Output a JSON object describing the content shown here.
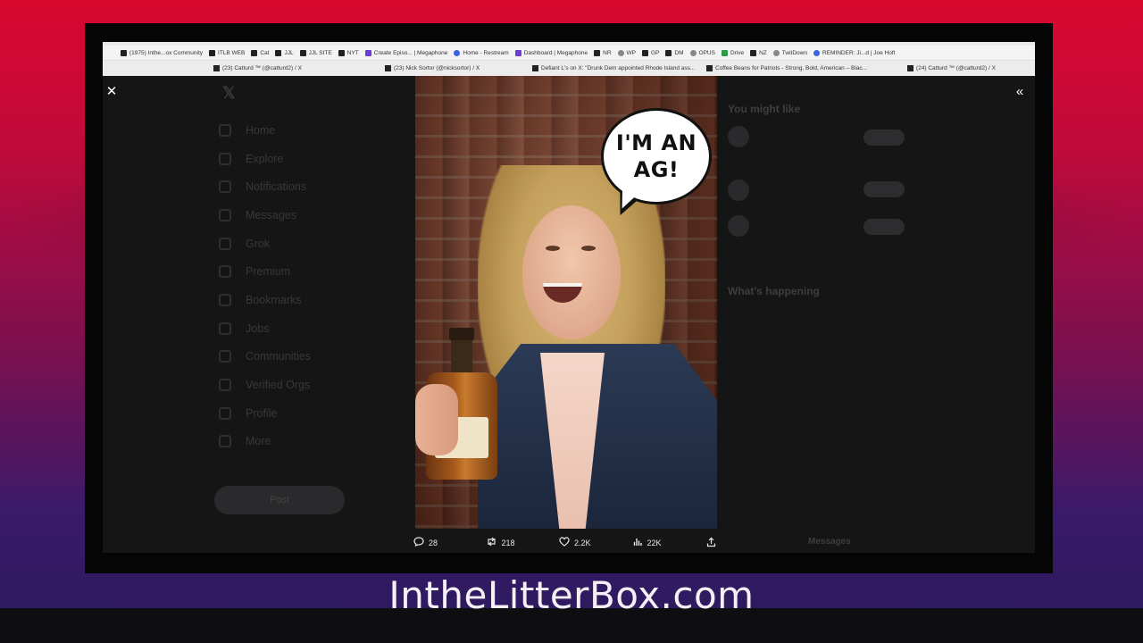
{
  "bookmarks_row1": [
    {
      "icon": "apps-icon",
      "label": "(1975) Inthe...ox Community"
    },
    {
      "icon": "itlb-icon",
      "label": "ITLB WEB"
    },
    {
      "icon": "x-icon",
      "label": "Cat"
    },
    {
      "icon": "x-icon",
      "label": "JJL"
    },
    {
      "icon": "jjl-icon",
      "label": "JJL SITE"
    },
    {
      "icon": "nyt-icon",
      "label": "NYT"
    },
    {
      "icon": "megaphone-icon",
      "label": "Create Episo... | Megaphone"
    },
    {
      "icon": "restream-icon",
      "label": "Home - Restream"
    },
    {
      "icon": "megaphone-icon",
      "label": "Dashboard | Megaphone"
    },
    {
      "icon": "nr-icon",
      "label": "NR"
    },
    {
      "icon": "globe-icon",
      "label": "WP"
    },
    {
      "icon": "gp-icon",
      "label": "GP"
    },
    {
      "icon": "dm-icon",
      "label": "DM"
    },
    {
      "icon": "opus-icon",
      "label": "OPUS"
    },
    {
      "icon": "drive-icon",
      "label": "Drive"
    },
    {
      "icon": "x-icon",
      "label": "NZ"
    },
    {
      "icon": "twitdown-icon",
      "label": "TwitDown"
    },
    {
      "icon": "reminder-icon",
      "label": "REMINDER: Ji...d | Joe Hoft"
    }
  ],
  "tabs_row2": [
    {
      "label": "(23) Catturd ™ (@catturd2) / X"
    },
    {
      "label": "(23) Nick Sortor (@nicksortor) / X"
    },
    {
      "label": "Defiant L's on X: \"Drunk Dem appointed Rhode Island ass..."
    },
    {
      "label": "Coffee Beans for Patriots - Strong, Bold, American – Blac..."
    },
    {
      "label": "(24) Catturd ™ (@catturd2) / X"
    }
  ],
  "left_nav": [
    "Home",
    "Explore",
    "Notifications",
    "Messages",
    "Grok",
    "Premium",
    "Bookmarks",
    "Jobs",
    "Communities",
    "Verified Orgs",
    "Profile",
    "More"
  ],
  "post_button": "Post",
  "right_col": {
    "you_might_like": "You might like",
    "whats_happening": "What's happening",
    "messages": "Messages"
  },
  "meme": {
    "bubble_text": "I'M AN\nAG!"
  },
  "actions": {
    "replies": "28",
    "reposts": "218",
    "likes": "2.2K",
    "views": "22K"
  },
  "footer_brand": "IntheLitterBox.com"
}
